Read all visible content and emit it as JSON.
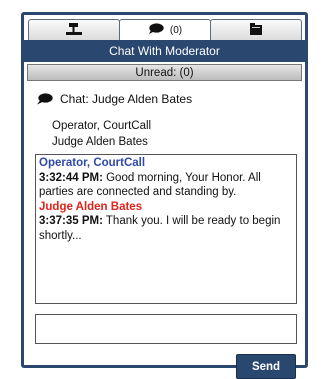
{
  "tabs": [
    {
      "icon": "gavel-icon",
      "label": ""
    },
    {
      "icon": "chat-bubble-icon",
      "label": "(0)"
    },
    {
      "icon": "folder-icon",
      "label": ""
    }
  ],
  "header": {
    "title": "Chat With Moderator"
  },
  "unread": {
    "label": "Unread: (0)"
  },
  "chat_target": {
    "icon": "chat-bubble-icon",
    "label": "Chat: Judge Alden Bates"
  },
  "participants": [
    "Operator, CourtCall",
    "Judge Alden Bates"
  ],
  "messages": [
    {
      "sender": "Operator, CourtCall",
      "time": "3:32:44 PM:",
      "text": " Good morning, Your Honor.  All parties are connected and standing by."
    },
    {
      "sender": "Judge Alden Bates",
      "time": "3:37:35 PM:",
      "text": " Thank you.  I will be ready to begin shortly..."
    }
  ],
  "compose": {
    "value": "",
    "placeholder": ""
  },
  "send_button": {
    "label": "Send"
  },
  "colors": {
    "navy": "#2a4770",
    "operator": "#2e49a8",
    "judge": "#e0231c"
  }
}
